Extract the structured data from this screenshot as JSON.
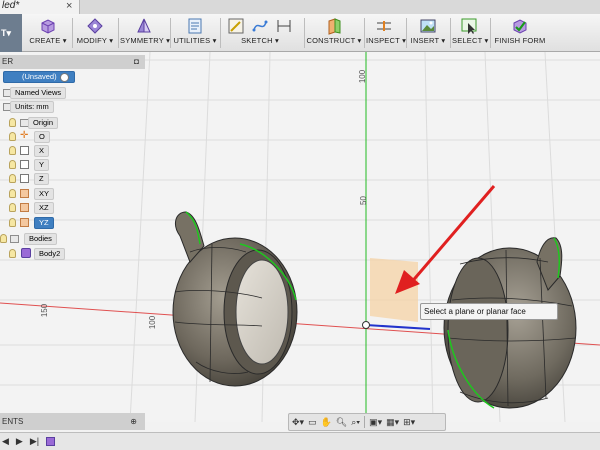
{
  "document": {
    "tab_title": "led*"
  },
  "toolbar": {
    "workspace_label": "T",
    "groups": [
      {
        "label": "CREATE"
      },
      {
        "label": "MODIFY"
      },
      {
        "label": "SYMMETRY"
      },
      {
        "label": "UTILITIES"
      },
      {
        "label": "SKETCH"
      },
      {
        "label": "CONSTRUCT"
      },
      {
        "label": "INSPECT"
      },
      {
        "label": "INSERT"
      },
      {
        "label": "SELECT"
      },
      {
        "label": "FINISH FORM"
      }
    ]
  },
  "browser": {
    "header": "ER",
    "root": "(Unsaved)",
    "items": [
      {
        "label": "Named Views"
      },
      {
        "label": "Units: mm"
      },
      {
        "label": "Origin"
      },
      {
        "label": "O"
      },
      {
        "label": "X"
      },
      {
        "label": "Y"
      },
      {
        "label": "Z"
      },
      {
        "label": "XY"
      },
      {
        "label": "XZ"
      },
      {
        "label": "YZ"
      },
      {
        "label": "Bodies"
      },
      {
        "label": "Body2"
      }
    ]
  },
  "viewport": {
    "tooltip": "Select a plane or planar face",
    "ruler_labels": [
      "100",
      "50",
      "150",
      "100"
    ]
  },
  "comments": {
    "label": "ENTS"
  },
  "colors": {
    "selection_blue": "#3f7fc1",
    "arrow_red": "#e02020",
    "green_axis": "#22bb22",
    "red_axis": "#e05050",
    "plane_orange": "#f6d3a6"
  }
}
